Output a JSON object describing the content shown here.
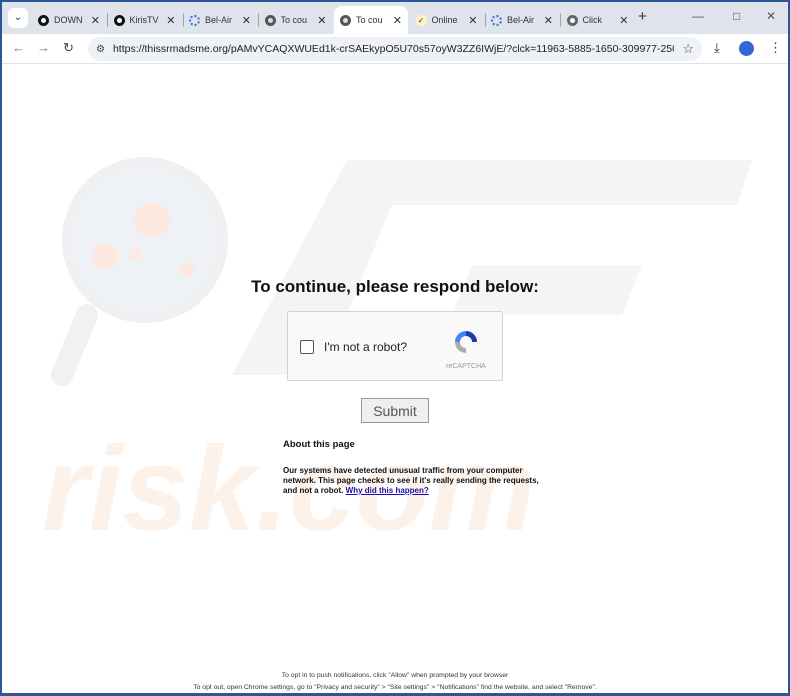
{
  "browser": {
    "tabs": [
      {
        "title": "DOWN",
        "icon": "black-circle-icon",
        "color": "#111111"
      },
      {
        "title": "KirisTV",
        "icon": "black-circle-icon",
        "color": "#111111"
      },
      {
        "title": "Bel-Air",
        "icon": "loading-spinner-icon",
        "color": "#3b6fd6"
      },
      {
        "title": "To cou",
        "icon": "globe-icon",
        "color": "#555555"
      },
      {
        "title": "To cou",
        "icon": "globe-icon",
        "color": "#555555",
        "active": true
      },
      {
        "title": "Online",
        "icon": "check-icon",
        "color": "#e8c230"
      },
      {
        "title": "Bel-Air",
        "icon": "loading-spinner-icon",
        "color": "#3b6fd6"
      },
      {
        "title": "Click",
        "icon": "robot-icon",
        "color": "#666666"
      }
    ],
    "url": "https://thissrmadsme.org/pAMvYCAQXWUEd1k-crSAEkypO5U70s57oyW3ZZ6IWjE/?clck=11963-5885-1650-309977-25064-172..."
  },
  "page": {
    "heading": "To continue, please respond below:",
    "captcha": {
      "label": "I'm not a robot?",
      "brand": "reCAPTCHA",
      "checked": false
    },
    "submit": "Submit",
    "about_title": "About this page",
    "about_text": "Our systems have detected unusual traffic from your computer network. This page checks to see if it's really sending the requests, and not a robot. ",
    "about_link": "Why did this happen?",
    "footer_line1": "To opt in to push notifications, click \"Allow\" when prompted by your browser",
    "footer_line2": "To opt out, open Chrome settings, go to \"Privacy and security\" > \"Site settings\" > \"Notifications\" find the website, and select \"Remove\"."
  },
  "watermark": {
    "text": "PCrisk.com"
  }
}
